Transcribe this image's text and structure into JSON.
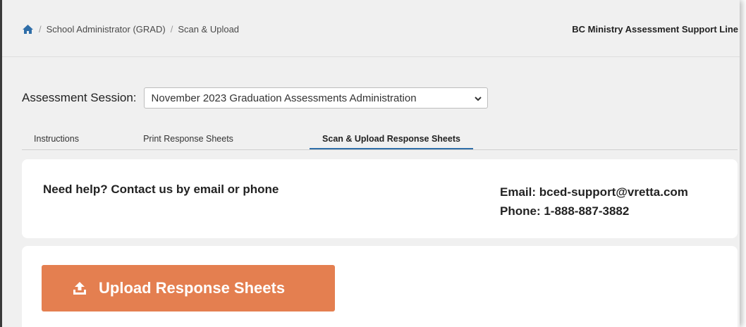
{
  "breadcrumb": {
    "icon": "home-icon",
    "items": [
      "School Administrator (GRAD)",
      "Scan & Upload"
    ],
    "separator": "/"
  },
  "header": {
    "support_line": "BC Ministry Assessment Support Line"
  },
  "session": {
    "label": "Assessment Session:",
    "selected": "November 2023 Graduation Assessments Administration"
  },
  "tabs": [
    {
      "label": "Instructions"
    },
    {
      "label": "Print Response Sheets"
    },
    {
      "label": "Scan & Upload Response Sheets",
      "active": true
    }
  ],
  "help": {
    "text": "Need help? Contact us by email or phone",
    "email": "Email: bced-support@vretta.com",
    "phone": "Phone: 1-888-887-3882"
  },
  "upload": {
    "label": "Upload Response Sheets",
    "icon": "upload-icon"
  },
  "colors": {
    "accent": "#e47f50",
    "tab_underline": "#2f6ea8",
    "home_icon": "#2f6ea8"
  }
}
